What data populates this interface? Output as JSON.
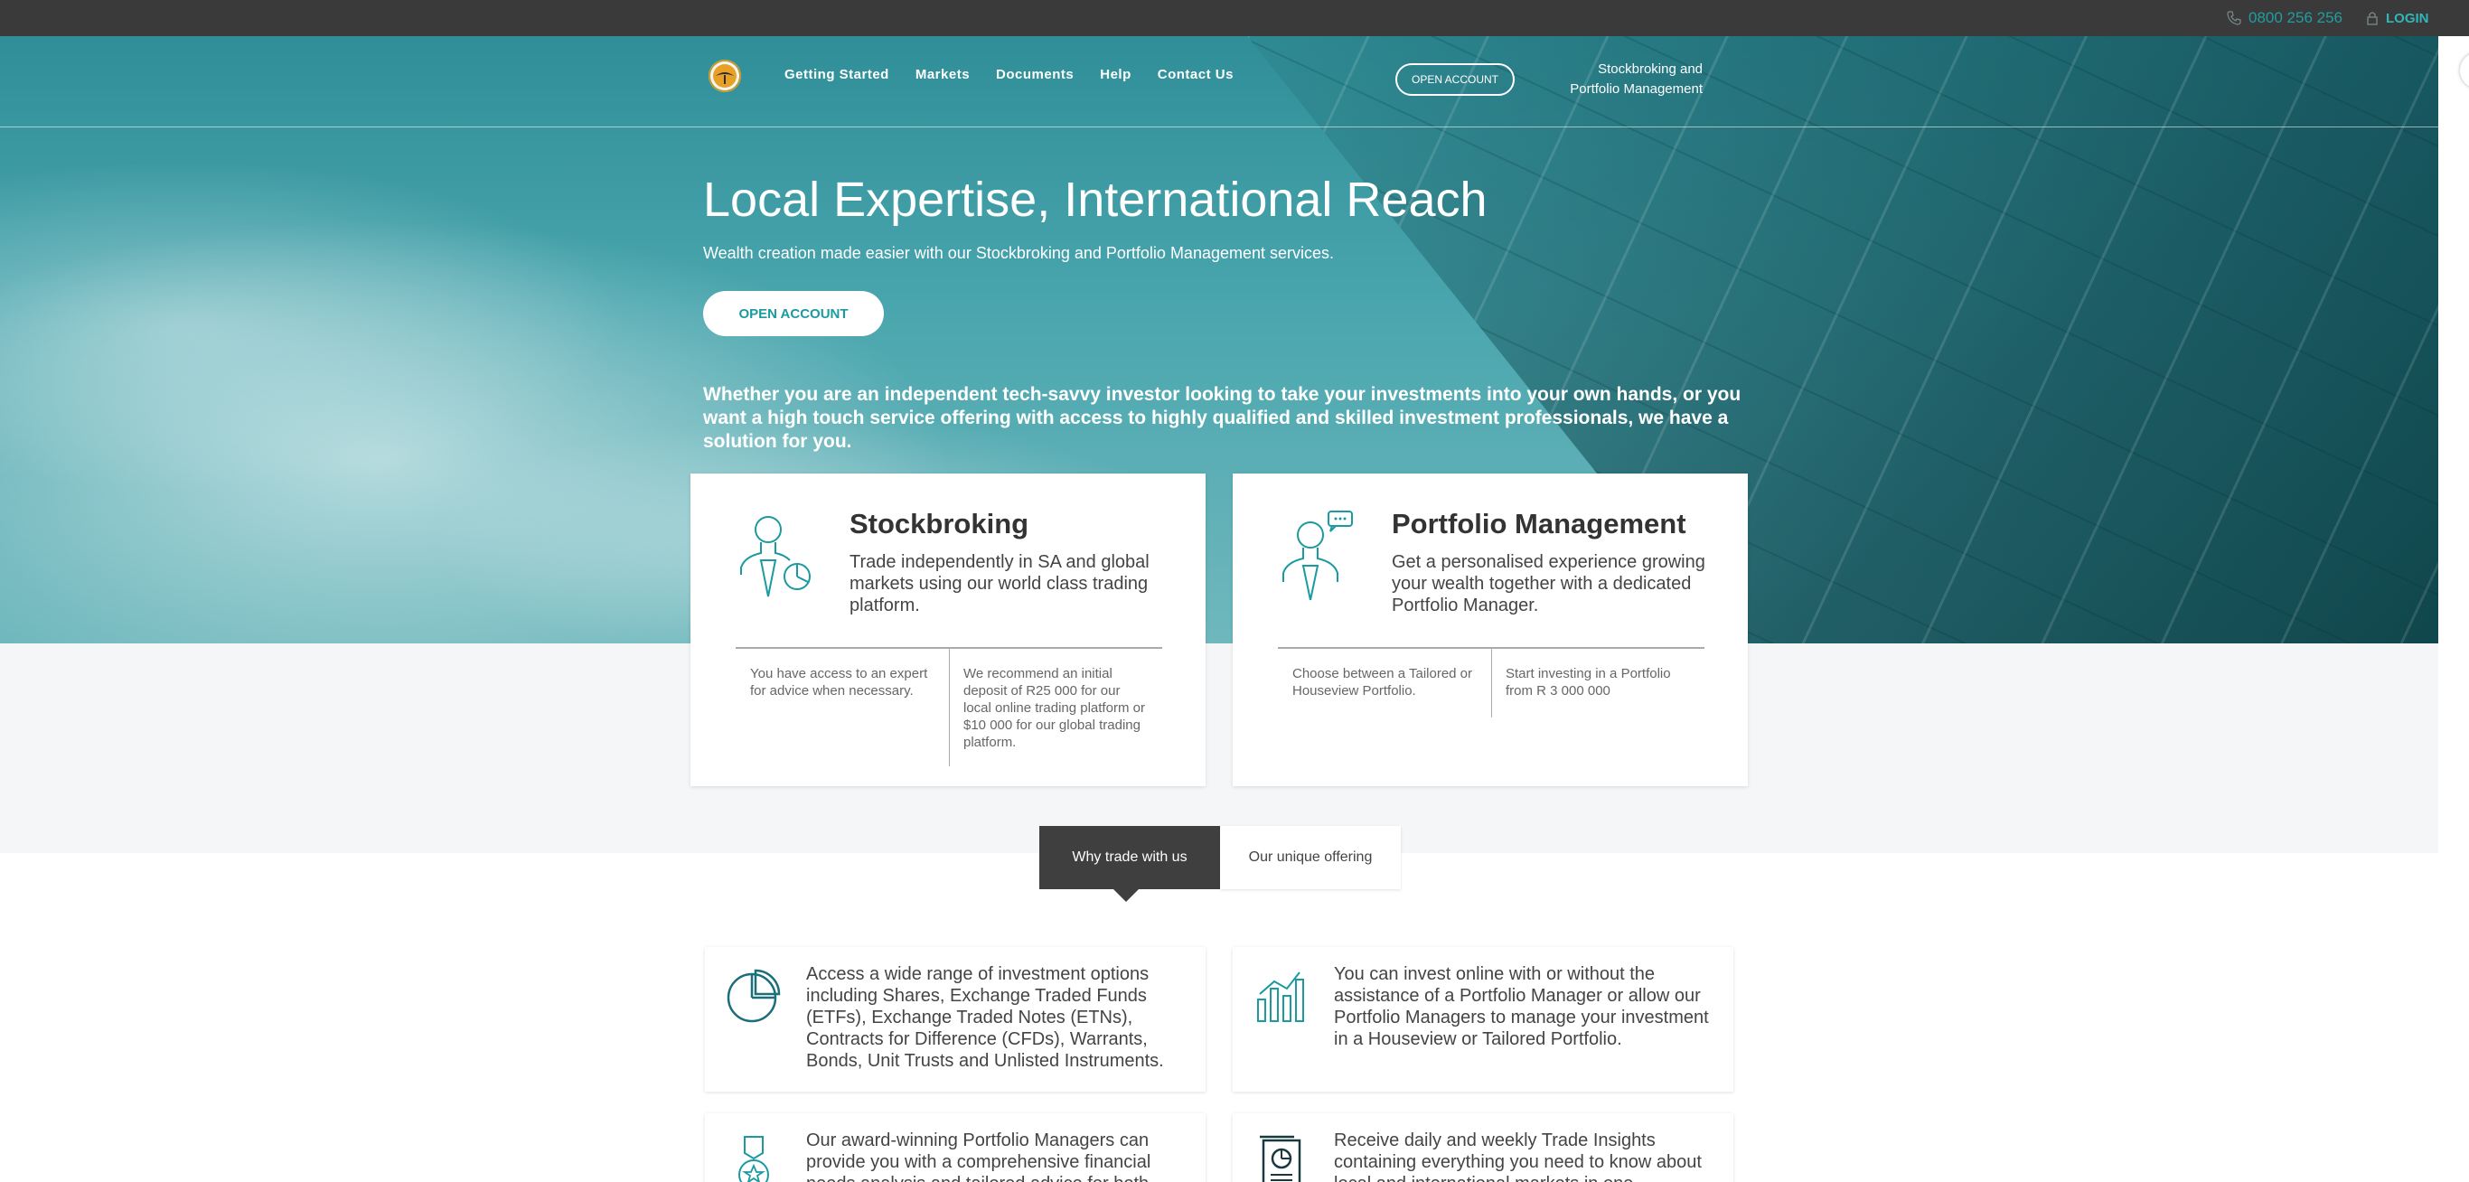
{
  "topbar": {
    "phone": "0800 256 256",
    "login": "LOGIN"
  },
  "nav": {
    "links": [
      "Getting Started",
      "Markets",
      "Documents",
      "Help",
      "Contact Us"
    ],
    "open_account": "OPEN ACCOUNT",
    "tagline_line1": "Stockbroking and",
    "tagline_line2": "Portfolio Management"
  },
  "hero": {
    "title": "Local Expertise, International Reach",
    "subtitle": "Wealth creation made easier with our Stockbroking and Portfolio Management services.",
    "cta": "OPEN ACCOUNT",
    "description": "Whether you are an independent tech-savvy investor looking to take your investments into your own hands, or you want a high touch service offering with access to highly qualified and skilled investment professionals, we have a solution for you."
  },
  "cards": [
    {
      "title": "Stockbroking",
      "text": "Trade independently in SA and global markets using our world class trading platform.",
      "col1": "You have access to an expert for advice when necessary.",
      "col2": "We recommend an initial deposit of R25 000 for our local online trading platform or $10 000 for our global trading platform.",
      "icon": "person-chart-icon"
    },
    {
      "title": "Portfolio Management",
      "text": "Get a personalised experience growing your wealth together with a dedicated Portfolio Manager.",
      "col1": "Choose between a Tailored or Houseview Portfolio.",
      "col2": "Start investing in a Portfolio from R 3 000 000",
      "icon": "person-speech-icon"
    }
  ],
  "tabs": {
    "active": "Why trade with us",
    "inactive": "Our unique offering"
  },
  "features": [
    {
      "text": "Access a wide range of investment options including Shares, Exchange Traded Funds (ETFs), Exchange Traded Notes (ETNs), Contracts for Difference (CFDs), Warrants, Bonds, Unit Trusts and Unlisted Instruments.",
      "icon": "pie-chart-icon"
    },
    {
      "text": "You can invest online with or without the assistance of a Portfolio Manager or allow our Portfolio Managers to manage your investment in a Houseview or Tailored Portfolio.",
      "icon": "bar-chart-icon"
    },
    {
      "text": "Our award-winning Portfolio Managers can provide you with a comprehensive financial needs analysis and tailored advice for both local and",
      "icon": "medal-icon"
    },
    {
      "text": "Receive daily and weekly Trade Insights containing everything you need to know about local and international markets in one information-packed",
      "icon": "document-chart-icon"
    }
  ],
  "colors": {
    "accent": "#1b9aa0",
    "topbar": "#3a3a3a",
    "tab_active": "#3f3f3f"
  }
}
